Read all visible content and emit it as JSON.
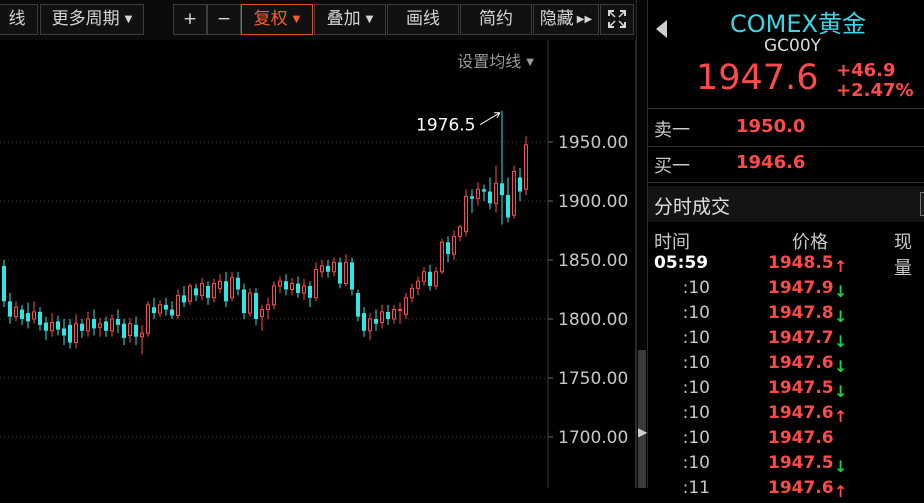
{
  "toolbar": {
    "partial_label": "线",
    "period_label": "更多周期",
    "zoom_in": "+",
    "zoom_out": "−",
    "adjust_label": "复权",
    "overlay_label": "叠加",
    "draw_label": "画线",
    "simple_label": "简约",
    "hide_label": "隐藏"
  },
  "chart": {
    "ma_setting_label": "设置均线",
    "high_label": "1976.5",
    "up_color": "#ff4a4a",
    "down_color": "#2ee6e6",
    "grid_color": "#3a3a3a",
    "price_levels": [
      1950,
      1900,
      1850,
      1800,
      1750,
      1700
    ],
    "price_tick_labels": [
      "1950.00",
      "1900.00",
      "1850.00",
      "1800.00",
      "1750.00",
      "1700.00"
    ],
    "candles": [
      [
        1845,
        1815,
        1850,
        1810
      ],
      [
        1815,
        1802,
        1822,
        1796
      ],
      [
        1802,
        1810,
        1815,
        1798
      ],
      [
        1808,
        1800,
        1812,
        1795
      ],
      [
        1805,
        1798,
        1814,
        1792
      ],
      [
        1800,
        1806,
        1815,
        1796
      ],
      [
        1806,
        1795,
        1810,
        1790
      ],
      [
        1797,
        1790,
        1802,
        1782
      ],
      [
        1790,
        1797,
        1805,
        1785
      ],
      [
        1798,
        1791,
        1803,
        1786
      ],
      [
        1792,
        1786,
        1800,
        1778
      ],
      [
        1795,
        1780,
        1800,
        1775
      ],
      [
        1780,
        1796,
        1804,
        1775
      ],
      [
        1796,
        1790,
        1800,
        1784
      ],
      [
        1790,
        1800,
        1806,
        1785
      ],
      [
        1800,
        1792,
        1808,
        1786
      ],
      [
        1793,
        1796,
        1801,
        1785
      ],
      [
        1798,
        1790,
        1802,
        1785
      ],
      [
        1790,
        1800,
        1804,
        1785
      ],
      [
        1800,
        1795,
        1808,
        1788
      ],
      [
        1796,
        1784,
        1800,
        1778
      ],
      [
        1786,
        1796,
        1801,
        1780
      ],
      [
        1795,
        1785,
        1802,
        1778
      ],
      [
        1785,
        1788,
        1795,
        1770
      ],
      [
        1788,
        1812,
        1815,
        1785
      ],
      [
        1810,
        1805,
        1818,
        1800
      ],
      [
        1805,
        1812,
        1816,
        1802
      ],
      [
        1812,
        1808,
        1818,
        1803
      ],
      [
        1808,
        1803,
        1815,
        1800
      ],
      [
        1803,
        1820,
        1825,
        1800
      ],
      [
        1820,
        1814,
        1828,
        1810
      ],
      [
        1815,
        1828,
        1830,
        1812
      ],
      [
        1826,
        1820,
        1830,
        1815
      ],
      [
        1820,
        1830,
        1835,
        1816
      ],
      [
        1828,
        1818,
        1832,
        1812
      ],
      [
        1818,
        1830,
        1834,
        1814
      ],
      [
        1826,
        1832,
        1838,
        1822
      ],
      [
        1832,
        1815,
        1840,
        1810
      ],
      [
        1818,
        1835,
        1840,
        1815
      ],
      [
        1835,
        1825,
        1840,
        1820
      ],
      [
        1825,
        1805,
        1830,
        1800
      ],
      [
        1805,
        1822,
        1826,
        1802
      ],
      [
        1822,
        1800,
        1826,
        1795
      ],
      [
        1802,
        1808,
        1812,
        1790
      ],
      [
        1808,
        1812,
        1818,
        1800
      ],
      [
        1812,
        1828,
        1832,
        1808
      ],
      [
        1828,
        1832,
        1836,
        1822
      ],
      [
        1832,
        1825,
        1838,
        1820
      ],
      [
        1825,
        1830,
        1835,
        1820
      ],
      [
        1830,
        1822,
        1836,
        1818
      ],
      [
        1822,
        1828,
        1834,
        1816
      ],
      [
        1828,
        1818,
        1832,
        1810
      ],
      [
        1818,
        1842,
        1848,
        1815
      ],
      [
        1840,
        1845,
        1850,
        1835
      ],
      [
        1845,
        1840,
        1850,
        1835
      ],
      [
        1840,
        1848,
        1852,
        1836
      ],
      [
        1848,
        1830,
        1852,
        1826
      ],
      [
        1830,
        1848,
        1855,
        1828
      ],
      [
        1848,
        1825,
        1852,
        1820
      ],
      [
        1822,
        1802,
        1825,
        1798
      ],
      [
        1805,
        1790,
        1810,
        1785
      ],
      [
        1790,
        1800,
        1805,
        1782
      ],
      [
        1800,
        1796,
        1808,
        1790
      ],
      [
        1797,
        1806,
        1812,
        1792
      ],
      [
        1806,
        1800,
        1812,
        1795
      ],
      [
        1800,
        1808,
        1812,
        1796
      ],
      [
        1808,
        1808,
        1814,
        1796
      ],
      [
        1804,
        1818,
        1822,
        1800
      ],
      [
        1818,
        1826,
        1830,
        1814
      ],
      [
        1826,
        1832,
        1836,
        1820
      ],
      [
        1832,
        1840,
        1844,
        1828
      ],
      [
        1840,
        1828,
        1846,
        1824
      ],
      [
        1828,
        1840,
        1844,
        1825
      ],
      [
        1840,
        1865,
        1868,
        1838
      ],
      [
        1865,
        1855,
        1870,
        1848
      ],
      [
        1855,
        1870,
        1875,
        1850
      ],
      [
        1870,
        1878,
        1880,
        1866
      ],
      [
        1874,
        1904,
        1910,
        1870
      ],
      [
        1904,
        1902,
        1910,
        1890
      ],
      [
        1902,
        1910,
        1916,
        1896
      ],
      [
        1910,
        1908,
        1914,
        1900
      ],
      [
        1908,
        1898,
        1920,
        1893
      ],
      [
        1898,
        1915,
        1930,
        1890
      ],
      [
        1915,
        1905,
        1976.5,
        1880
      ],
      [
        1905,
        1886,
        1920,
        1882
      ],
      [
        1888,
        1925,
        1930,
        1885
      ],
      [
        1920,
        1908,
        1928,
        1900
      ],
      [
        1910,
        1947.6,
        1955,
        1905
      ]
    ]
  },
  "quote": {
    "name": "COMEX黄金",
    "code": "GC00Y",
    "last": "1947.6",
    "change": "+46.9",
    "change_pct": "+2.47%",
    "ask_label": "卖一",
    "ask": "1950.0",
    "bid_label": "买一",
    "bid": "1946.6"
  },
  "ticks": {
    "title": "分时成交",
    "col_time": "时间",
    "col_price": "价格",
    "col_volume": "现量",
    "rows": [
      {
        "time": "05:59",
        "price": "1948.5",
        "dir": "up"
      },
      {
        "time": ":10",
        "price": "1947.9",
        "dir": "down"
      },
      {
        "time": ":10",
        "price": "1947.8",
        "dir": "down"
      },
      {
        "time": ":10",
        "price": "1947.7",
        "dir": "down"
      },
      {
        "time": ":10",
        "price": "1947.6",
        "dir": "down"
      },
      {
        "time": ":10",
        "price": "1947.5",
        "dir": "down"
      },
      {
        "time": ":10",
        "price": "1947.6",
        "dir": "up"
      },
      {
        "time": ":10",
        "price": "1947.6",
        "dir": "none"
      },
      {
        "time": ":10",
        "price": "1947.5",
        "dir": "down"
      },
      {
        "time": ":11",
        "price": "1947.6",
        "dir": "up"
      }
    ]
  }
}
